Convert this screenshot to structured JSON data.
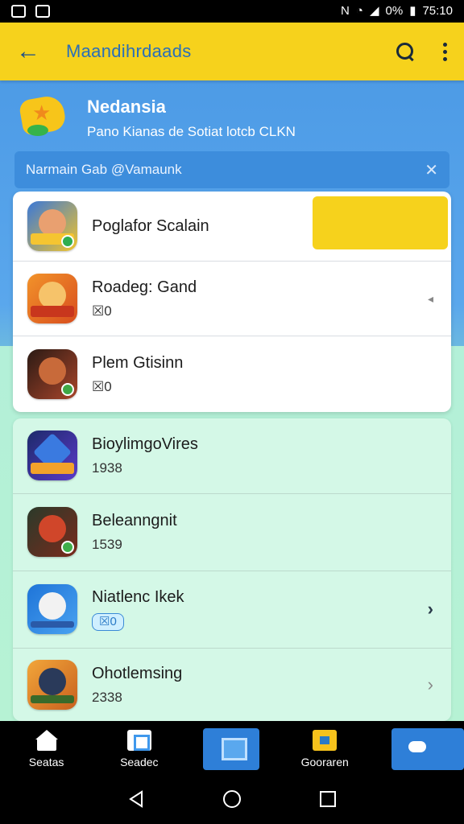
{
  "status_bar": {
    "time": "75:10",
    "battery": "0%"
  },
  "app_bar": {
    "title": "Maandihrdaads"
  },
  "header": {
    "title": "Nedansia",
    "subtitle": "Pano Kianas de Sotiat lotcb CLKN"
  },
  "search_strip": {
    "text": "Narmain Gab @Vamaunk"
  },
  "card1": {
    "items": [
      {
        "title": "Poglafor Scalain",
        "subtitle": ""
      },
      {
        "title": "Roadeg: Gand",
        "subtitle": "☒0"
      },
      {
        "title": "Plem Gtisinn",
        "subtitle": "☒0"
      }
    ]
  },
  "card2": {
    "items": [
      {
        "title": "BioylimgoVires",
        "subtitle": "1938"
      },
      {
        "title": "Beleanngnit",
        "subtitle": "1539"
      },
      {
        "title": "Niatlenc Ikek",
        "subtitle": "☒0"
      },
      {
        "title": "Ohotlemsing",
        "subtitle": "2338"
      }
    ]
  },
  "bottom_nav": {
    "items": [
      {
        "label": "Seatas"
      },
      {
        "label": "Seadec"
      },
      {
        "label": ""
      },
      {
        "label": "Gooraren"
      },
      {
        "label": ""
      }
    ]
  },
  "colors": {
    "accent_yellow": "#f6d21c",
    "primary_blue": "#3f98ec"
  }
}
